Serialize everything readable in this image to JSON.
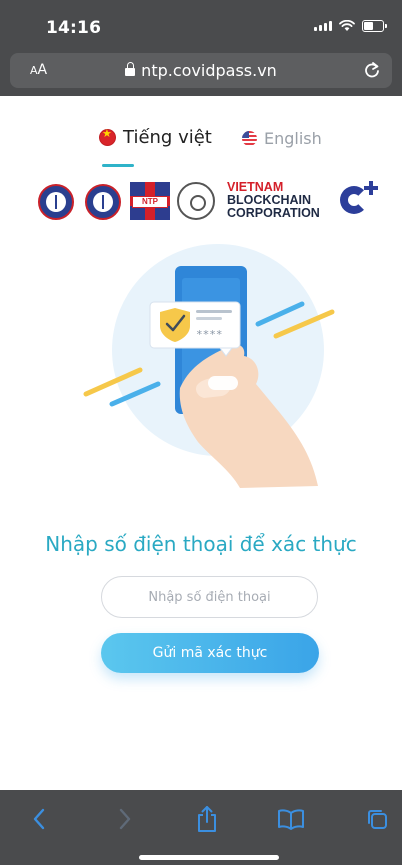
{
  "status_bar": {
    "time": "14:16"
  },
  "browser": {
    "aa_label_small": "A",
    "aa_label_big": "A",
    "url": "ntp.covidpass.vn"
  },
  "language_tabs": [
    {
      "label": "Tiếng việt",
      "flag": "vietnam-flag-icon",
      "active": true
    },
    {
      "label": "English",
      "flag": "us-flag-icon",
      "active": false
    }
  ],
  "logos": {
    "vbc_line1": "VIETNAM",
    "vbc_line2": "BLOCKCHAIN",
    "vbc_line3": "CORPORATION",
    "ntp_label": "NTP"
  },
  "illustration": {
    "pin_mask": "****"
  },
  "form": {
    "title": "Nhập số điện thoại để xác thực",
    "phone_placeholder": "Nhập số điện thoại",
    "phone_value": "",
    "submit_label": "Gửi mã xác thực"
  },
  "colors": {
    "accent": "#2aa9c3",
    "button_start": "#5bc7ee",
    "button_end": "#3aa4e8",
    "chrome": "#4a4b4d",
    "toolbar_icon": "#3b8fe0",
    "toolbar_icon_disabled": "#5f6a78"
  }
}
